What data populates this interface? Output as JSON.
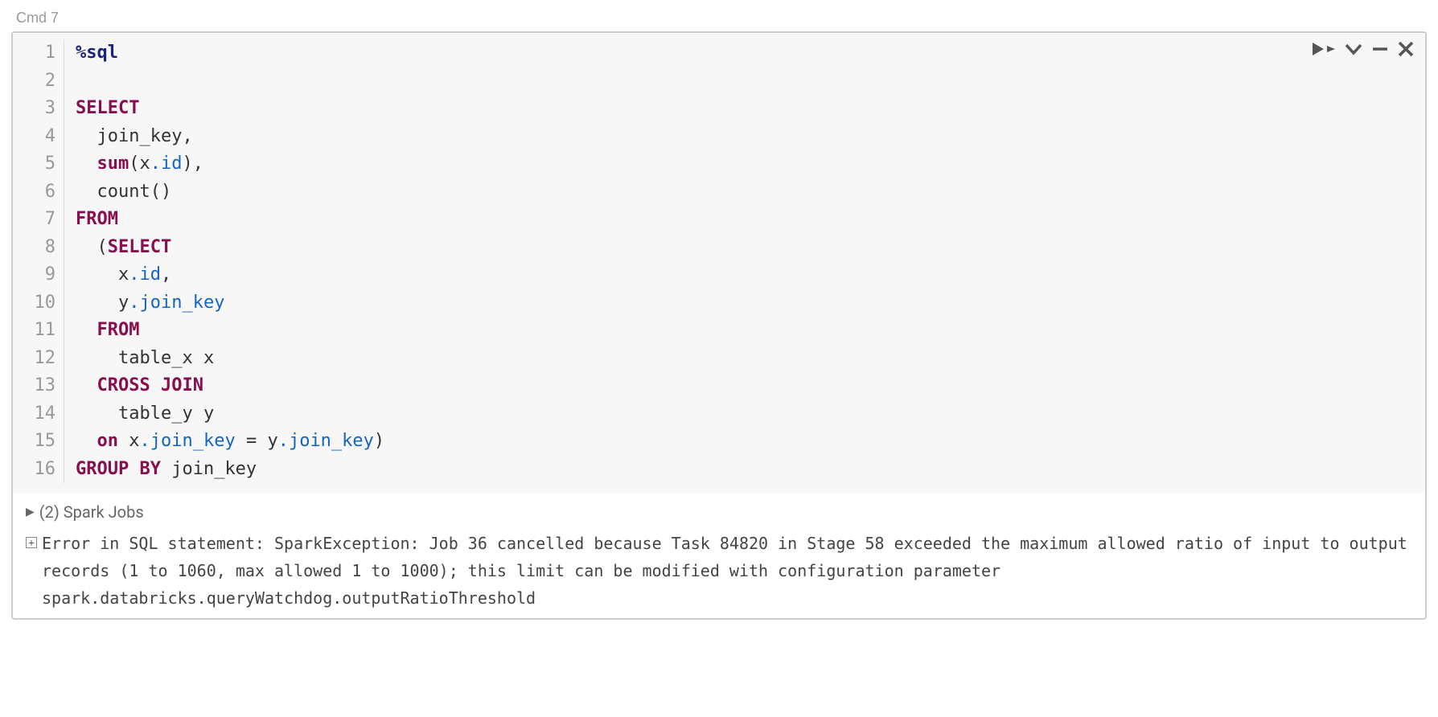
{
  "cell": {
    "cmd_label": "Cmd 7",
    "lines": [
      {
        "n": "1",
        "tokens": [
          {
            "t": "%sql",
            "c": "magic"
          }
        ]
      },
      {
        "n": "2",
        "tokens": []
      },
      {
        "n": "3",
        "tokens": [
          {
            "t": "SELECT",
            "c": "kw"
          }
        ]
      },
      {
        "n": "4",
        "tokens": [
          {
            "t": "  join_key,",
            "c": "plain"
          }
        ]
      },
      {
        "n": "5",
        "tokens": [
          {
            "t": "  ",
            "c": "plain"
          },
          {
            "t": "sum",
            "c": "kw"
          },
          {
            "t": "(x",
            "c": "plain"
          },
          {
            "t": ".id",
            "c": "prop"
          },
          {
            "t": "),",
            "c": "plain"
          }
        ]
      },
      {
        "n": "6",
        "tokens": [
          {
            "t": "  count()",
            "c": "plain"
          }
        ]
      },
      {
        "n": "7",
        "tokens": [
          {
            "t": "FROM",
            "c": "kw"
          }
        ]
      },
      {
        "n": "8",
        "tokens": [
          {
            "t": "  (",
            "c": "plain"
          },
          {
            "t": "SELECT",
            "c": "kw"
          }
        ]
      },
      {
        "n": "9",
        "tokens": [
          {
            "t": "    x",
            "c": "plain"
          },
          {
            "t": ".id",
            "c": "prop"
          },
          {
            "t": ",",
            "c": "plain"
          }
        ]
      },
      {
        "n": "10",
        "tokens": [
          {
            "t": "    y",
            "c": "plain"
          },
          {
            "t": ".join_key",
            "c": "prop"
          }
        ]
      },
      {
        "n": "11",
        "tokens": [
          {
            "t": "  ",
            "c": "plain"
          },
          {
            "t": "FROM",
            "c": "kw"
          }
        ]
      },
      {
        "n": "12",
        "tokens": [
          {
            "t": "    table_x x",
            "c": "plain"
          }
        ]
      },
      {
        "n": "13",
        "tokens": [
          {
            "t": "  ",
            "c": "plain"
          },
          {
            "t": "CROSS JOIN",
            "c": "kw"
          }
        ]
      },
      {
        "n": "14",
        "tokens": [
          {
            "t": "    table_y y",
            "c": "plain"
          }
        ]
      },
      {
        "n": "15",
        "tokens": [
          {
            "t": "  ",
            "c": "plain"
          },
          {
            "t": "on",
            "c": "kw"
          },
          {
            "t": " x",
            "c": "plain"
          },
          {
            "t": ".join_key",
            "c": "prop"
          },
          {
            "t": " = y",
            "c": "plain"
          },
          {
            "t": ".join_key",
            "c": "prop"
          },
          {
            "t": ")",
            "c": "plain"
          }
        ]
      },
      {
        "n": "16",
        "tokens": [
          {
            "t": "GROUP BY",
            "c": "kw"
          },
          {
            "t": " join_key",
            "c": "plain"
          }
        ]
      }
    ]
  },
  "output": {
    "spark_jobs_label": "(2) Spark Jobs",
    "error_message": "Error in SQL statement: SparkException: Job 36 cancelled because Task 84820 in Stage 58 exceeded the maximum allowed ratio of input to output records (1 to 1060, max allowed 1 to 1000); this limit can be modified with configuration parameter spark.databricks.queryWatchdog.outputRatioThreshold"
  }
}
